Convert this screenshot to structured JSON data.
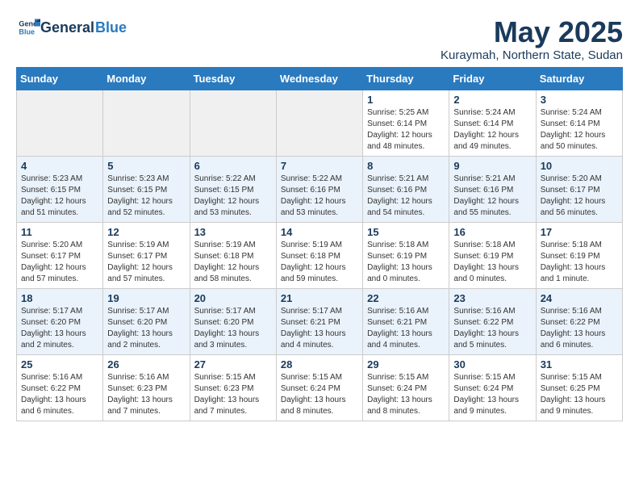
{
  "logo": {
    "general": "General",
    "blue": "Blue"
  },
  "title": "May 2025",
  "subtitle": "Kuraymah, Northern State, Sudan",
  "days_of_week": [
    "Sunday",
    "Monday",
    "Tuesday",
    "Wednesday",
    "Thursday",
    "Friday",
    "Saturday"
  ],
  "weeks": [
    [
      {
        "day": "",
        "info": ""
      },
      {
        "day": "",
        "info": ""
      },
      {
        "day": "",
        "info": ""
      },
      {
        "day": "",
        "info": ""
      },
      {
        "day": "1",
        "info": "Sunrise: 5:25 AM\nSunset: 6:14 PM\nDaylight: 12 hours\nand 48 minutes."
      },
      {
        "day": "2",
        "info": "Sunrise: 5:24 AM\nSunset: 6:14 PM\nDaylight: 12 hours\nand 49 minutes."
      },
      {
        "day": "3",
        "info": "Sunrise: 5:24 AM\nSunset: 6:14 PM\nDaylight: 12 hours\nand 50 minutes."
      }
    ],
    [
      {
        "day": "4",
        "info": "Sunrise: 5:23 AM\nSunset: 6:15 PM\nDaylight: 12 hours\nand 51 minutes."
      },
      {
        "day": "5",
        "info": "Sunrise: 5:23 AM\nSunset: 6:15 PM\nDaylight: 12 hours\nand 52 minutes."
      },
      {
        "day": "6",
        "info": "Sunrise: 5:22 AM\nSunset: 6:15 PM\nDaylight: 12 hours\nand 53 minutes."
      },
      {
        "day": "7",
        "info": "Sunrise: 5:22 AM\nSunset: 6:16 PM\nDaylight: 12 hours\nand 53 minutes."
      },
      {
        "day": "8",
        "info": "Sunrise: 5:21 AM\nSunset: 6:16 PM\nDaylight: 12 hours\nand 54 minutes."
      },
      {
        "day": "9",
        "info": "Sunrise: 5:21 AM\nSunset: 6:16 PM\nDaylight: 12 hours\nand 55 minutes."
      },
      {
        "day": "10",
        "info": "Sunrise: 5:20 AM\nSunset: 6:17 PM\nDaylight: 12 hours\nand 56 minutes."
      }
    ],
    [
      {
        "day": "11",
        "info": "Sunrise: 5:20 AM\nSunset: 6:17 PM\nDaylight: 12 hours\nand 57 minutes."
      },
      {
        "day": "12",
        "info": "Sunrise: 5:19 AM\nSunset: 6:17 PM\nDaylight: 12 hours\nand 57 minutes."
      },
      {
        "day": "13",
        "info": "Sunrise: 5:19 AM\nSunset: 6:18 PM\nDaylight: 12 hours\nand 58 minutes."
      },
      {
        "day": "14",
        "info": "Sunrise: 5:19 AM\nSunset: 6:18 PM\nDaylight: 12 hours\nand 59 minutes."
      },
      {
        "day": "15",
        "info": "Sunrise: 5:18 AM\nSunset: 6:19 PM\nDaylight: 13 hours\nand 0 minutes."
      },
      {
        "day": "16",
        "info": "Sunrise: 5:18 AM\nSunset: 6:19 PM\nDaylight: 13 hours\nand 0 minutes."
      },
      {
        "day": "17",
        "info": "Sunrise: 5:18 AM\nSunset: 6:19 PM\nDaylight: 13 hours\nand 1 minute."
      }
    ],
    [
      {
        "day": "18",
        "info": "Sunrise: 5:17 AM\nSunset: 6:20 PM\nDaylight: 13 hours\nand 2 minutes."
      },
      {
        "day": "19",
        "info": "Sunrise: 5:17 AM\nSunset: 6:20 PM\nDaylight: 13 hours\nand 2 minutes."
      },
      {
        "day": "20",
        "info": "Sunrise: 5:17 AM\nSunset: 6:20 PM\nDaylight: 13 hours\nand 3 minutes."
      },
      {
        "day": "21",
        "info": "Sunrise: 5:17 AM\nSunset: 6:21 PM\nDaylight: 13 hours\nand 4 minutes."
      },
      {
        "day": "22",
        "info": "Sunrise: 5:16 AM\nSunset: 6:21 PM\nDaylight: 13 hours\nand 4 minutes."
      },
      {
        "day": "23",
        "info": "Sunrise: 5:16 AM\nSunset: 6:22 PM\nDaylight: 13 hours\nand 5 minutes."
      },
      {
        "day": "24",
        "info": "Sunrise: 5:16 AM\nSunset: 6:22 PM\nDaylight: 13 hours\nand 6 minutes."
      }
    ],
    [
      {
        "day": "25",
        "info": "Sunrise: 5:16 AM\nSunset: 6:22 PM\nDaylight: 13 hours\nand 6 minutes."
      },
      {
        "day": "26",
        "info": "Sunrise: 5:16 AM\nSunset: 6:23 PM\nDaylight: 13 hours\nand 7 minutes."
      },
      {
        "day": "27",
        "info": "Sunrise: 5:15 AM\nSunset: 6:23 PM\nDaylight: 13 hours\nand 7 minutes."
      },
      {
        "day": "28",
        "info": "Sunrise: 5:15 AM\nSunset: 6:24 PM\nDaylight: 13 hours\nand 8 minutes."
      },
      {
        "day": "29",
        "info": "Sunrise: 5:15 AM\nSunset: 6:24 PM\nDaylight: 13 hours\nand 8 minutes."
      },
      {
        "day": "30",
        "info": "Sunrise: 5:15 AM\nSunset: 6:24 PM\nDaylight: 13 hours\nand 9 minutes."
      },
      {
        "day": "31",
        "info": "Sunrise: 5:15 AM\nSunset: 6:25 PM\nDaylight: 13 hours\nand 9 minutes."
      }
    ]
  ]
}
